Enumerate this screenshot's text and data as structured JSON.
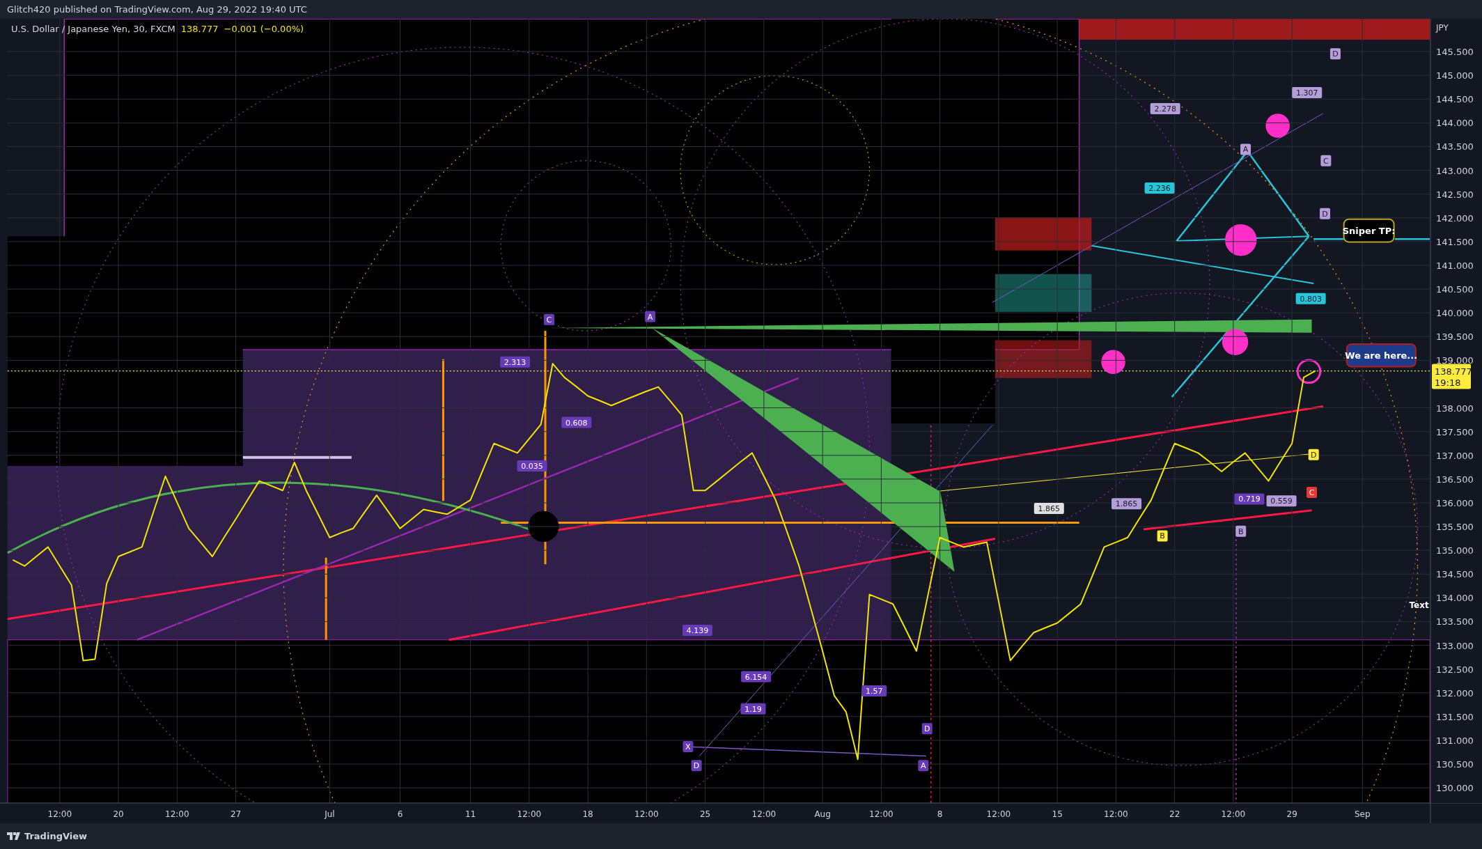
{
  "header": {
    "publisher": "Glitch420 published on TradingView.com, Aug 29, 2022 19:40 UTC"
  },
  "legend": {
    "symbol": "U.S. Dollar / Japanese Yen, 30, FXCM",
    "last": "138.777",
    "change": "−0.001 (−0.00%)"
  },
  "chart": {
    "chart_data": {
      "type": "line",
      "categories": [
        null,
        null,
        null,
        null,
        "12:00",
        null,
        null,
        null,
        null,
        "20",
        null,
        null,
        null,
        null,
        "12:00",
        null,
        null,
        null,
        null,
        "27",
        null,
        null,
        null,
        null,
        null,
        null,
        null,
        "Jul",
        null,
        null,
        null,
        null,
        null,
        "6",
        null,
        null,
        null,
        null,
        null,
        "11",
        null,
        null,
        null,
        null,
        "12:00",
        null,
        null,
        null,
        null,
        "18",
        null,
        null,
        null,
        null,
        "12:00",
        null,
        null,
        null,
        null,
        "25",
        null,
        null,
        null,
        null,
        "12:00",
        null,
        null,
        null,
        null,
        "Aug",
        null,
        null,
        null,
        null,
        "12:00",
        null,
        null,
        null,
        null,
        "8",
        null,
        null,
        null,
        null,
        "12:00",
        null,
        null,
        null,
        null,
        "15",
        null,
        null,
        null,
        null,
        "12:00",
        null,
        null,
        null,
        null,
        "22",
        null,
        null,
        null,
        null,
        "12:00",
        null,
        null,
        null,
        null,
        "29",
        null,
        null,
        null,
        null,
        null,
        "Sep"
      ],
      "series": [
        {
          "color": "#f5e400",
          "values": [
            134.8,
            134.67,
            134.87,
            135.07,
            134.67,
            134.27,
            132.68,
            132.71,
            134.3,
            134.87,
            134.97,
            135.07,
            135.82,
            136.56,
            136.01,
            135.46,
            135.17,
            134.87,
            135.27,
            135.66,
            136.06,
            136.46,
            136.36,
            136.26,
            136.85,
            136.26,
            135.77,
            135.27,
            135.37,
            135.46,
            135.81,
            136.16,
            135.81,
            135.46,
            135.66,
            135.86,
            135.81,
            135.76,
            135.91,
            136.06,
            136.66,
            137.25,
            137.15,
            137.05,
            137.35,
            137.65,
            138.93,
            138.64,
            138.45,
            138.25,
            138.15,
            138.05,
            138.15,
            138.25,
            138.35,
            138.44,
            138.15,
            137.85,
            136.26,
            136.26,
            136.46,
            136.66,
            136.86,
            137.05,
            136.56,
            136.06,
            135.37,
            134.67,
            133.78,
            132.88,
            131.94,
            131.6,
            130.6,
            134.07,
            133.97,
            133.87,
            133.38,
            132.88,
            134.08,
            135.27,
            135.17,
            135.07,
            135.12,
            135.17,
            133.93,
            132.68,
            132.98,
            133.27,
            133.37,
            133.47,
            133.67,
            133.87,
            134.47,
            135.07,
            135.17,
            135.27,
            135.67,
            136.06,
            136.66,
            137.25,
            137.15,
            137.05,
            136.86,
            136.66,
            136.86,
            137.05,
            136.76,
            136.46,
            136.86,
            137.25,
            138.64,
            138.78,
            null,
            null,
            null,
            null
          ]
        }
      ],
      "ylim": [
        129.68,
        146.19
      ],
      "grid": true,
      "yticks": [
        {
          "value": 145.5,
          "label": "145.500"
        },
        {
          "value": 145,
          "label": "145.000"
        },
        {
          "value": 144.5,
          "label": "144.500"
        },
        {
          "value": 144,
          "label": "144.000"
        },
        {
          "value": 143.5,
          "label": "143.500"
        },
        {
          "value": 143,
          "label": "143.000"
        },
        {
          "value": 142.5,
          "label": "142.500"
        },
        {
          "value": 142,
          "label": "142.000"
        },
        {
          "value": 141.5,
          "label": "141.500"
        },
        {
          "value": 141,
          "label": "141.000"
        },
        {
          "value": 140.5,
          "label": "140.500"
        },
        {
          "value": 140,
          "label": "140.000"
        },
        {
          "value": 139.5,
          "label": "139.500"
        },
        {
          "value": 139,
          "label": "139.000"
        },
        {
          "value": 138,
          "label": "138.000"
        },
        {
          "value": 137.5,
          "label": "137.500"
        },
        {
          "value": 137,
          "label": "137.000"
        },
        {
          "value": 136.5,
          "label": "136.500"
        },
        {
          "value": 136,
          "label": "136.000"
        },
        {
          "value": 135.5,
          "label": "135.500"
        },
        {
          "value": 135,
          "label": "135.000"
        },
        {
          "value": 134.5,
          "label": "134.500"
        },
        {
          "value": 134,
          "label": "134.000"
        },
        {
          "value": 133.5,
          "label": "133.500"
        },
        {
          "value": 133,
          "label": "133.000"
        },
        {
          "value": 132.5,
          "label": "132.500"
        },
        {
          "value": 132,
          "label": "132.000"
        },
        {
          "value": 131.5,
          "label": "131.500"
        },
        {
          "value": 131,
          "label": "131.000"
        },
        {
          "value": 130.5,
          "label": "130.500"
        },
        {
          "value": 130,
          "label": "130.000"
        }
      ]
    },
    "currency": "JPY",
    "price_badge": {
      "price": "138.777",
      "countdown": "19:18"
    },
    "pattern_labels": [
      {
        "text": "C",
        "color": "#673ab7"
      },
      {
        "text": "A",
        "color": "#673ab7"
      },
      {
        "text": "2.313",
        "color": "#673ab7"
      },
      {
        "text": "0.608",
        "color": "#673ab7"
      },
      {
        "text": "0.035",
        "color": "#673ab7"
      },
      {
        "text": "4.139",
        "color": "#673ab7"
      },
      {
        "text": "6.154",
        "color": "#673ab7"
      },
      {
        "text": "1.19",
        "color": "#673ab7"
      },
      {
        "text": "1.57",
        "color": "#673ab7"
      },
      {
        "text": "X",
        "color": "#673ab7"
      },
      {
        "text": "D",
        "color": "#673ab7"
      },
      {
        "text": "D",
        "color": "#673ab7"
      },
      {
        "text": "A",
        "color": "#673ab7"
      },
      {
        "text": "1.865",
        "color": "#e0e0e0"
      },
      {
        "text": "1.865",
        "color": "#b39ddb"
      },
      {
        "text": "2.278",
        "color": "#b39ddb"
      },
      {
        "text": "2.236",
        "color": "#26c6da"
      },
      {
        "text": "0.803",
        "color": "#26c6da"
      },
      {
        "text": "0.719",
        "color": "#673ab7"
      },
      {
        "text": "0.559",
        "color": "#b39ddb"
      },
      {
        "text": "D",
        "color": "#b39ddb"
      },
      {
        "text": "C",
        "color": "#b39ddb"
      },
      {
        "text": "D",
        "color": "#b39ddb"
      },
      {
        "text": "D",
        "color": "#ffeb3b"
      },
      {
        "text": "C",
        "color": "#e53935"
      },
      {
        "text": "B",
        "color": "#ffeb3b"
      },
      {
        "text": "B",
        "color": "#b39ddb"
      },
      {
        "text": "A",
        "color": "#b39ddb"
      },
      {
        "text": "1.307",
        "color": "#b39ddb"
      }
    ],
    "callouts": [
      {
        "kind": "note",
        "text": "Sniper TP:"
      },
      {
        "kind": "pin",
        "text": "We are here..."
      },
      {
        "kind": "text",
        "text": "Text"
      }
    ]
  },
  "footer": {
    "brand": "TradingView"
  }
}
